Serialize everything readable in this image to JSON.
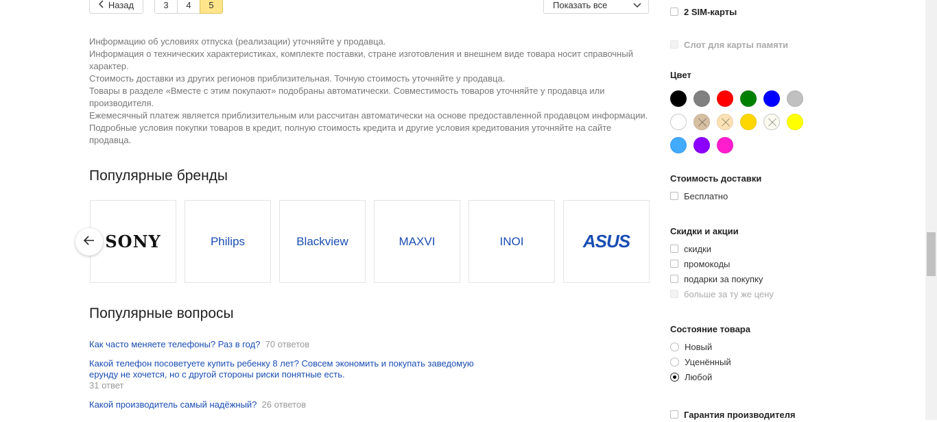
{
  "pagination": {
    "back_label": "Назад",
    "pages": [
      "3",
      "4",
      "5"
    ],
    "active_page": "5",
    "show_all_label": "Показать все"
  },
  "disclaimer": [
    "Информацию об условиях отпуска (реализации) уточняйте у продавца.",
    "Информация о технических характеристиках, комплекте поставки, стране изготовления и внешнем виде товара носит справочный характер.",
    "Стоимость доставки из других регионов приблизительная. Точную стоимость уточняйте у продавца.",
    "Товары в разделе «Вместе с этим покупают» подобраны автоматически. Совместимость товаров уточняйте у продавца или производителя.",
    "Ежемесячный платеж является приблизительным или рассчитан автоматически на основе предоставленной продавцом информации.",
    "Подробные условия покупки товаров в кредит, полную стоимость кредита и другие условия кредитования уточняйте на сайте продавца."
  ],
  "brands": {
    "title": "Популярные бренды",
    "items": [
      "SONY",
      "Philips",
      "Blackview",
      "MAXVI",
      "INOI",
      "ASUS"
    ]
  },
  "questions": {
    "title": "Популярные вопросы",
    "items": [
      {
        "text": "Как часто меняете телефоны? Раз в год?",
        "count": "70 ответов"
      },
      {
        "text": "Какой телефон посоветуете купить ребенку 8 лет? Совсем экономить и покупать заведомую ерунду не хочется, но с другой стороны риски понятные есть.",
        "count": "31 ответ"
      },
      {
        "text": "Какой производитель самый надёжный?",
        "count": "26 ответов"
      }
    ]
  },
  "sidebar": {
    "sim_label": "2 SIM-карты",
    "memory_slot_label": "Слот для карты памяти",
    "color_title": "Цвет",
    "colors": [
      {
        "hex": "#000000",
        "cross": false
      },
      {
        "hex": "#808080",
        "cross": false
      },
      {
        "hex": "#ff0000",
        "cross": false
      },
      {
        "hex": "#008000",
        "cross": false
      },
      {
        "hex": "#0000ff",
        "cross": false
      },
      {
        "hex": "#c0c0c0",
        "cross": false
      },
      {
        "hex": "#ffffff",
        "cross": false
      },
      {
        "hex": "#d7bfa4",
        "cross": true
      },
      {
        "hex": "#fde2b6",
        "cross": true
      },
      {
        "hex": "#ffd700",
        "cross": false
      },
      {
        "hex": "#fbfbf0",
        "cross": true
      },
      {
        "hex": "#ffff00",
        "cross": false
      },
      {
        "hex": "#42aaff",
        "cross": false
      },
      {
        "hex": "#8b00ff",
        "cross": false
      },
      {
        "hex": "#ff1dce",
        "cross": false
      }
    ],
    "delivery_title": "Стоимость доставки",
    "delivery_free": "Бесплатно",
    "discounts_title": "Скидки и акции",
    "discounts": [
      "скидки",
      "промокоды",
      "подарки за покупку"
    ],
    "discount_disabled": "больше за ту же цену",
    "condition_title": "Состояние товара",
    "conditions": [
      "Новый",
      "Уценённый",
      "Любой"
    ],
    "condition_selected": "Любой",
    "warranty_label": "Гарантия производителя"
  }
}
